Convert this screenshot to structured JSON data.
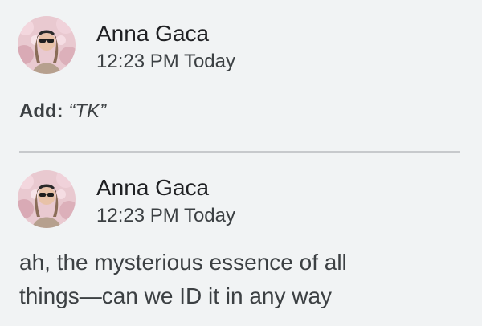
{
  "comments": [
    {
      "author": "Anna Gaca",
      "timestamp": "12:23 PM Today",
      "avatar": "profile-photo",
      "suggestion": {
        "action": "Add:",
        "text": "“TK”"
      }
    },
    {
      "author": "Anna Gaca",
      "timestamp": "12:23 PM Today",
      "avatar": "profile-photo",
      "body_lines": [
        "ah, the mysterious essence of all",
        "things—can we ID it in any way"
      ]
    }
  ],
  "colors": {
    "background": "#f1f3f4",
    "text": "#202124",
    "secondary_text": "#3c4043",
    "divider": "#c7c9cc"
  }
}
